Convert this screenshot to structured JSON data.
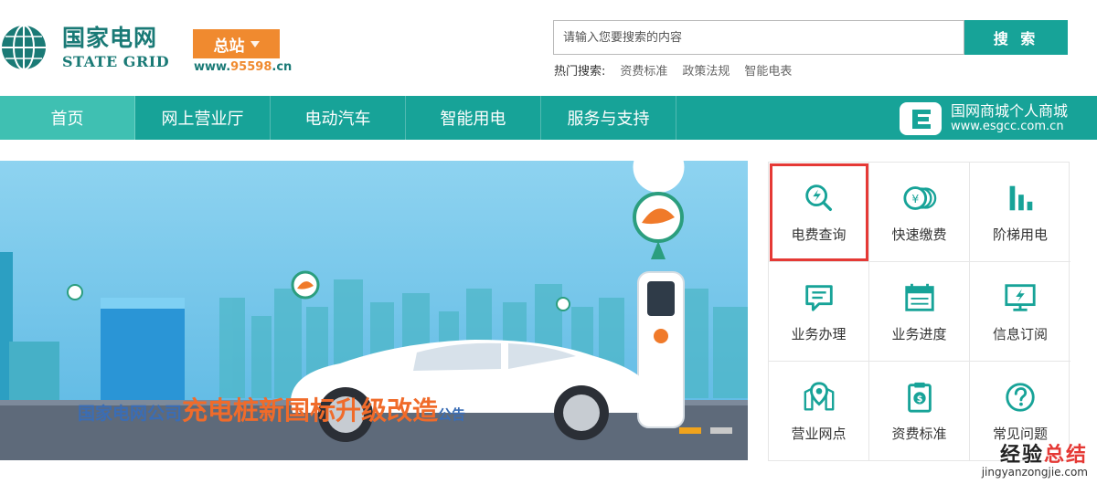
{
  "brand": {
    "name_cn": "国家电网",
    "name_en": "STATE GRID",
    "station_label": "总站",
    "url_prefix": "www.",
    "url_num": "95598",
    "url_suffix": ".cn"
  },
  "search": {
    "placeholder": "请输入您要搜索的内容",
    "button_label": "搜 索",
    "hot_label": "热门搜索:",
    "hot_items": [
      "资费标准",
      "政策法规",
      "智能电表"
    ]
  },
  "nav": {
    "items": [
      "首页",
      "网上营业厅",
      "电动汽车",
      "智能用电",
      "服务与支持"
    ],
    "active_index": 0,
    "mall": {
      "title": "国网商城个人商城",
      "url": "www.esgcc.com.cn"
    }
  },
  "banner": {
    "title_prefix": "国家电网公司",
    "title_main": "充电桩新国标升级改造",
    "title_suffix": "公告",
    "slide_count": 2,
    "active_slide": 0
  },
  "quick_services": [
    {
      "label": "电费查询",
      "icon": "search-bolt-icon",
      "highlighted": true
    },
    {
      "label": "快速缴费",
      "icon": "coins-icon",
      "highlighted": false
    },
    {
      "label": "阶梯用电",
      "icon": "bar-chart-icon",
      "highlighted": false
    },
    {
      "label": "业务办理",
      "icon": "message-icon",
      "highlighted": false
    },
    {
      "label": "业务进度",
      "icon": "calendar-icon",
      "highlighted": false
    },
    {
      "label": "信息订阅",
      "icon": "monitor-bolt-icon",
      "highlighted": false
    },
    {
      "label": "营业网点",
      "icon": "map-pin-icon",
      "highlighted": false
    },
    {
      "label": "资费标准",
      "icon": "clipboard-dollar-icon",
      "highlighted": false
    },
    {
      "label": "常见问题",
      "icon": "question-icon",
      "highlighted": false
    }
  ],
  "colors": {
    "primary": "#17a398",
    "nav_active": "#3fc0b2",
    "brand_dark": "#1a7a76",
    "orange": "#f08a2f",
    "highlight": "#e53935"
  },
  "watermark": {
    "part1": "经验",
    "part2": "总结",
    "url": "jingyanzongjie.com"
  }
}
